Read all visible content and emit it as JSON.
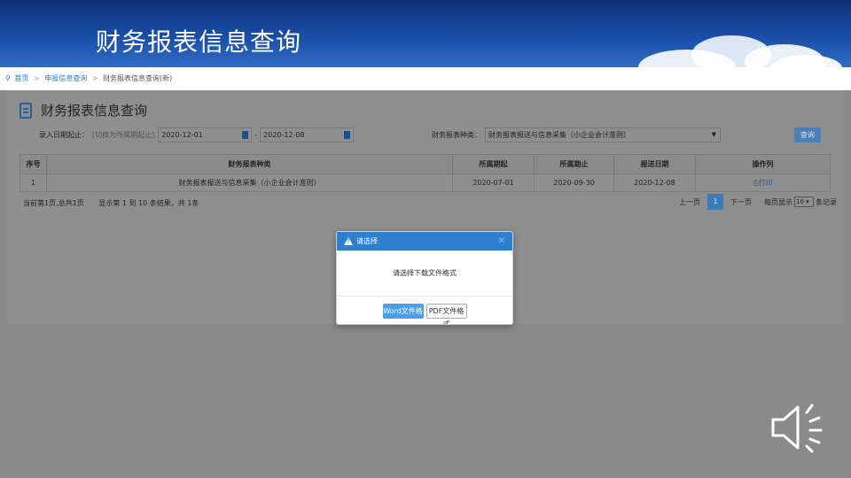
{
  "banner": {
    "title": "财务报表信息查询"
  },
  "breadcrumb": {
    "home": "首页",
    "sep": ">",
    "level2": "申报信息查询",
    "current": "财务报表信息查询(新)"
  },
  "page": {
    "title": "财务报表信息查询",
    "filters": {
      "date_label": "录入日期起止：",
      "date_hint": "[切换为所属期起止]",
      "date_from": "2020-12-01",
      "date_dash": "-",
      "date_to": "2020-12-08",
      "type_label": "财务报表种类：",
      "type_value": "财务报表报送与信息采集（小企业会计准则）",
      "query_label": "查询"
    },
    "table": {
      "headers": [
        "序号",
        "财务报表种类",
        "所属期起",
        "所属期止",
        "报送日期",
        "操作列"
      ],
      "rows": [
        {
          "index": "1",
          "type": "财务报表报送与信息采集（小企业会计准则）",
          "start": "2020-07-01",
          "end": "2020-09-30",
          "date": "2020-12-08",
          "op": "打印"
        }
      ]
    },
    "pager": {
      "info_left": "当前第1页,总共1页",
      "info_mid": "显示第 1 到 10 条结果，共 1条",
      "prev": "上一页",
      "current": "1",
      "next": "下一页",
      "per_page_label": "每页显示",
      "per_page_value": "10",
      "per_page_suffix": "条记录"
    }
  },
  "modal": {
    "title": "请选择",
    "message": "请选择下载文件格式",
    "word_btn": "Word文件格式",
    "pdf_btn": "PDF文件格式"
  },
  "colors": {
    "banner": "#1a4ea8",
    "modal_header": "#2f7fd0",
    "primary_button": "#4aa0e6",
    "overlay": "#8a8a8a"
  }
}
